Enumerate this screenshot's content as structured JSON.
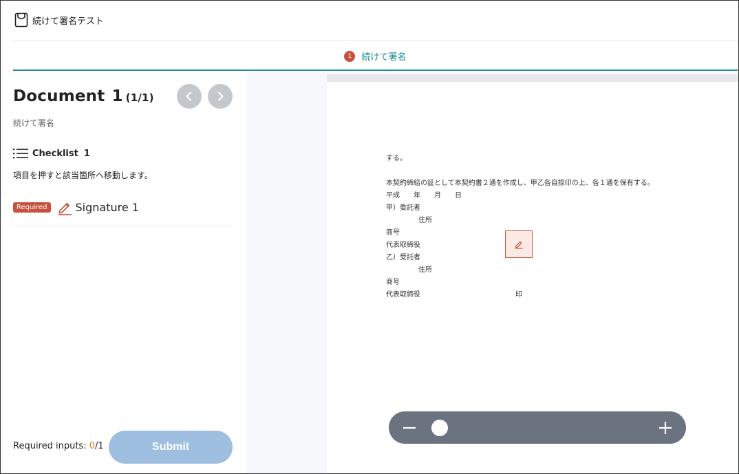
{
  "header": {
    "title": "続けて署名テスト"
  },
  "steps": [
    {
      "number": "1",
      "label": "続けて署名"
    }
  ],
  "document": {
    "title": "Document",
    "number": "1",
    "count": "(1/1)",
    "subtitle": "続けて署名"
  },
  "checklist": {
    "title": "Checklist",
    "count": "1",
    "description": "項目を押すと該当箇所へ移動します。",
    "items": [
      {
        "badge": "Required",
        "label": "Signature 1"
      }
    ]
  },
  "footer": {
    "required_label": "Required inputs: ",
    "required_current": "0",
    "required_total": "/1",
    "submit_label": "Submit"
  },
  "page_text": {
    "line1": "する。",
    "line2": "本契約締結の証として本契約書２通を作成し、甲乙各自捺印の上、各１通を保有する。",
    "line3": "平成　　年　　月　　日",
    "line4": "甲）委託者",
    "line5": "住所",
    "line6": "商号",
    "line7": "代表取締役",
    "line8": "乙）受託者",
    "line9": "住所",
    "line10": "商号",
    "line11": "代表取締役",
    "seal": "印"
  },
  "zoom": {
    "level": 0.02
  },
  "icons": {
    "app": "document-icon",
    "prev": "chevron-left-icon",
    "next": "chevron-right-icon",
    "checklist": "list-icon",
    "signature": "pen-icon",
    "zoom_out": "minus-icon",
    "zoom_in": "plus-icon"
  },
  "colors": {
    "accent": "#2a8c94",
    "required": "#c8513d",
    "submit_disabled": "#9ebfe0",
    "zoom_bar": "#6b7280"
  }
}
